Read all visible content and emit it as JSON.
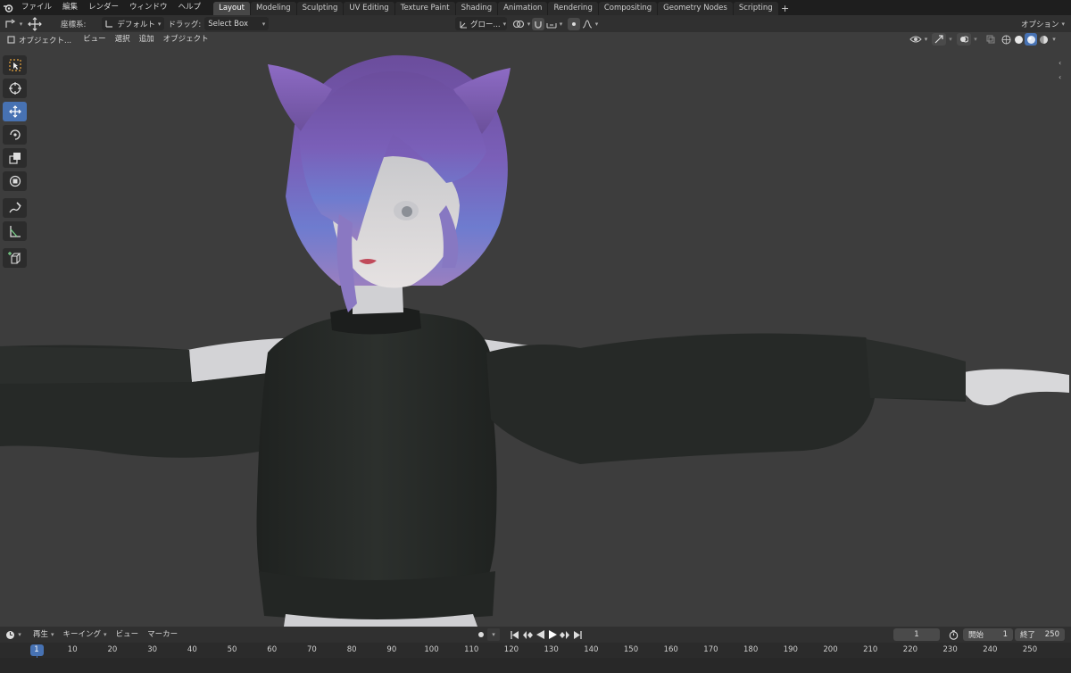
{
  "menu": {
    "items": [
      "ファイル",
      "編集",
      "レンダー",
      "ウィンドウ",
      "ヘルプ"
    ]
  },
  "workspaces": {
    "tabs": [
      "Layout",
      "Modeling",
      "Sculpting",
      "UV Editing",
      "Texture Paint",
      "Shading",
      "Animation",
      "Rendering",
      "Compositing",
      "Geometry Nodes",
      "Scripting"
    ],
    "active": "Layout"
  },
  "header1": {
    "orientation_label": "座標系:",
    "orientation_value": "デフォルト",
    "drag_label": "ドラッグ:",
    "drag_value": "Select Box",
    "transform_orientation": "グロー...",
    "options_label": "オプション"
  },
  "viewport_header": {
    "mode": "オブジェクト...",
    "menus": [
      "ビュー",
      "選択",
      "追加",
      "オブジェクト"
    ]
  },
  "timeline": {
    "menus": [
      "再生",
      "キーイング",
      "ビュー",
      "マーカー"
    ],
    "current_frame": "1",
    "start_label": "開始",
    "start_value": "1",
    "end_label": "終了",
    "end_value": "250",
    "ticks": [
      "1",
      "10",
      "20",
      "30",
      "40",
      "50",
      "60",
      "70",
      "80",
      "90",
      "100",
      "110",
      "120",
      "130",
      "140",
      "150",
      "160",
      "170",
      "180",
      "190",
      "200",
      "210",
      "220",
      "230",
      "240",
      "250"
    ]
  },
  "colors": {
    "accent": "#4772b3",
    "viewport_bg": "#3d3d3d",
    "header_bg": "#303030"
  }
}
